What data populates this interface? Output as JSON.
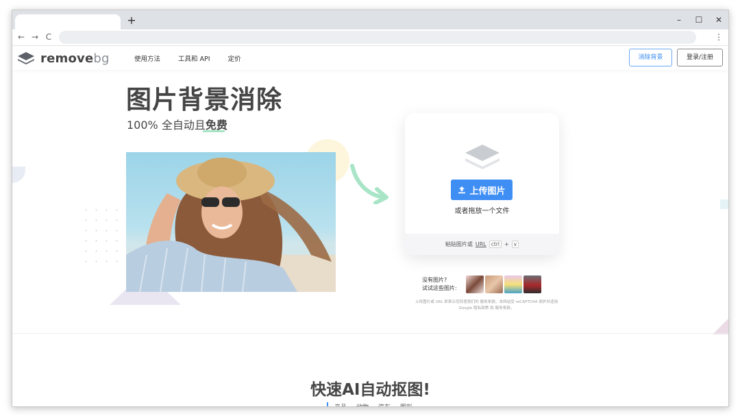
{
  "browser": {
    "tab_title": "",
    "new_tab_label": "+",
    "minimize_label": "–",
    "maximize_label": "☐",
    "close_label": "✕",
    "back_label": "←",
    "forward_label": "→",
    "reload_label": "C",
    "address": "",
    "menu_label": "⋮"
  },
  "header": {
    "logo_main": "remove",
    "logo_bg": "bg",
    "nav": [
      "使用方法",
      "工具和 API",
      "定价"
    ],
    "remove_bg_button": "消除背景",
    "login_button": "登录/注册"
  },
  "hero": {
    "title": "图片背景消除",
    "subtitle_prefix": "100% 全自动且",
    "subtitle_bold": "免费"
  },
  "upload": {
    "button_label": "上传图片",
    "drop_text": "或者拖放一个文件",
    "paste_prefix": "粘贴图片或",
    "paste_url": "URL",
    "kbd_ctrl": "ctrl",
    "kbd_plus": "+",
    "kbd_v": "v"
  },
  "samples": {
    "line1": "没有图片?",
    "line2": "试试这些图片:",
    "items": [
      "sample-woman",
      "sample-couple",
      "sample-cake",
      "sample-car"
    ]
  },
  "legal": {
    "line1": "上传图片或 URL 即表示您同意我们的 服务条款。本网站受 reCAPTCHA 保护并适用",
    "line2": "Google 隐私政策 和 服务条款。"
  },
  "section2": {
    "title": "快速AI自动抠图!",
    "categories": [
      "产品",
      "动物",
      "汽车",
      "图形"
    ]
  },
  "colors": {
    "accent_blue": "#3f8ef4",
    "arrow_green": "#a8e5c6",
    "text_dark": "#454545"
  }
}
